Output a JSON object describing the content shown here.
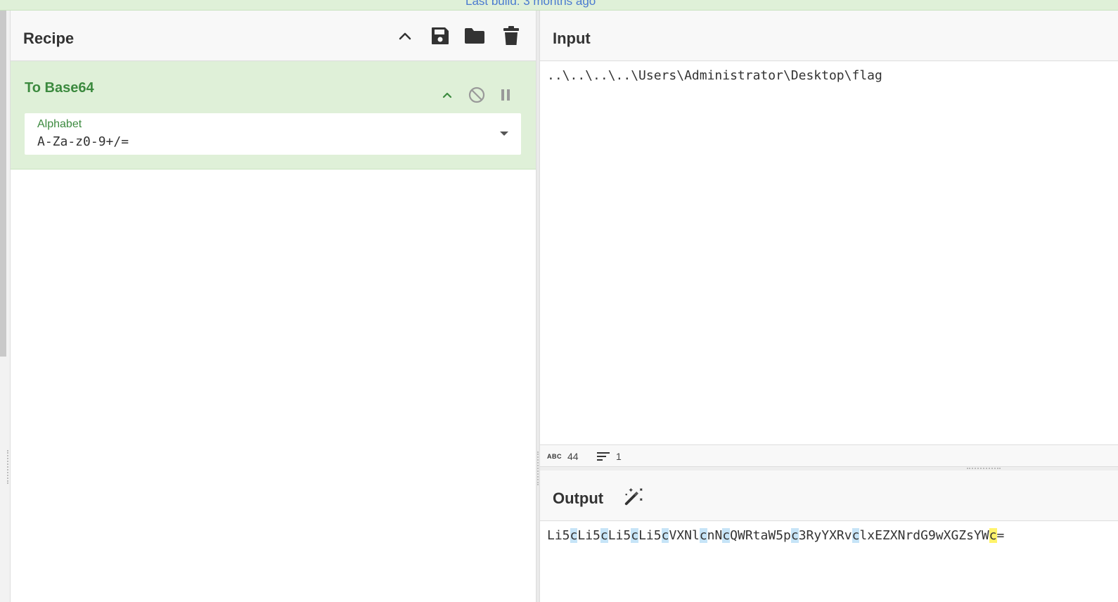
{
  "banner": {
    "text": "Last build: 3 months ago"
  },
  "recipe": {
    "title": "Recipe",
    "icons": [
      "chevron-up-icon",
      "save-icon",
      "folder-icon",
      "trash-icon"
    ],
    "operation": {
      "name": "To Base64",
      "icons": [
        "chevron-up-icon",
        "disable-icon",
        "pause-icon"
      ],
      "arg_label": "Alphabet",
      "arg_value": "A-Za-z0-9+/="
    }
  },
  "input": {
    "title": "Input",
    "text": "..\\..\\..\\..\\Users\\Administrator\\Desktop\\flag",
    "length": "44",
    "lines": "1"
  },
  "output": {
    "title": "Output",
    "magic_icon": "magic-wand-icon",
    "segments": [
      {
        "t": "Li5",
        "h": ""
      },
      {
        "t": "c",
        "h": "blue"
      },
      {
        "t": "Li5",
        "h": ""
      },
      {
        "t": "c",
        "h": "blue"
      },
      {
        "t": "Li5",
        "h": ""
      },
      {
        "t": "c",
        "h": "blue"
      },
      {
        "t": "Li5",
        "h": ""
      },
      {
        "t": "c",
        "h": "blue"
      },
      {
        "t": "VXNl",
        "h": ""
      },
      {
        "t": "c",
        "h": "blue"
      },
      {
        "t": "nN",
        "h": ""
      },
      {
        "t": "c",
        "h": "blue"
      },
      {
        "t": "QWRtaW5p",
        "h": ""
      },
      {
        "t": "c",
        "h": "blue"
      },
      {
        "t": "3RyYXRv",
        "h": ""
      },
      {
        "t": "c",
        "h": "blue"
      },
      {
        "t": "lxEZXNrdG9wXGZsYW",
        "h": ""
      },
      {
        "t": "c",
        "h": "yellow"
      },
      {
        "t": "=",
        "h": ""
      }
    ]
  },
  "colors": {
    "operation_bg": "#dff0d8",
    "operation_text": "#3c8a3f",
    "highlight_blue": "#c6e4f7",
    "highlight_yellow": "#fff36b"
  }
}
